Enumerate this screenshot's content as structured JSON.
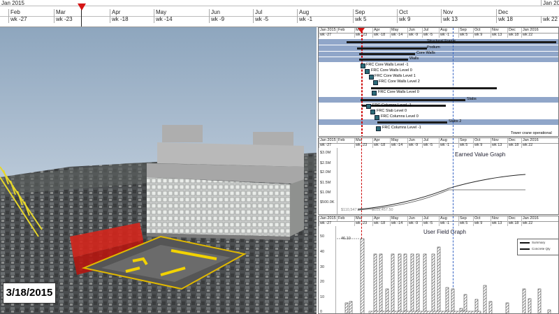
{
  "top_timeline": {
    "months": [
      {
        "label": "Jan 2015"
      },
      {
        "label": "Feb"
      },
      {
        "label": "Mar"
      },
      {
        "label": "Apr"
      },
      {
        "label": "May"
      },
      {
        "label": "Jun"
      },
      {
        "label": "Jul"
      },
      {
        "label": "Aug"
      },
      {
        "label": "Sep"
      },
      {
        "label": "Oct"
      },
      {
        "label": "Nov"
      },
      {
        "label": "Dec"
      },
      {
        "label": "Jan 2016"
      }
    ],
    "weeks": [
      "wk -27",
      "wk -23",
      "wk -18",
      "wk -14",
      "wk -9",
      "wk -5",
      "wk -1",
      "wk 5",
      "wk 9",
      "wk 13",
      "wk 18",
      "wk 22"
    ]
  },
  "view3d": {
    "date": "3/18/2015"
  },
  "gantt": {
    "months": [
      "Jan 2015",
      "Feb",
      "Mar",
      "Apr",
      "May",
      "Jun",
      "Jul",
      "Aug",
      "Sep",
      "Oct",
      "Nov",
      "Dec",
      "Jan 2016"
    ],
    "weeks": [
      "wk -27",
      "wk -23",
      "wk -18",
      "wk -14",
      "wk -9",
      "wk -5",
      "wk -1",
      "wk 5",
      "wk 9",
      "wk 13",
      "wk 18",
      "wk 22"
    ],
    "tasks": [
      "Structural Frame",
      "Podium",
      "Core Walls",
      "Walls",
      "FRC Core Walls Level -1",
      "FRC Core Walls Level 0",
      "FRC Core Walls Level 1",
      "FRC Core Walls Level 2",
      "FRC Core Walls Level 0",
      "Slabs",
      "Columns",
      "FRC Columns Level -1",
      "FRC Slab Level 0",
      "FRC Columns Level 0",
      "Slabs 2",
      "FRC Columns Level -1",
      "Tower crane operational"
    ]
  },
  "earned_value": {
    "title": "Earned Value Graph",
    "months": [
      "Jan 2015",
      "Feb",
      "Mar",
      "Apr",
      "May",
      "Jun",
      "Jul",
      "Aug",
      "Sep",
      "Oct",
      "Nov",
      "Dec",
      "Jan 2016"
    ],
    "weeks": [
      "wk -27",
      "wk -23",
      "wk -18",
      "wk -14",
      "wk -9",
      "wk -5",
      "wk -1",
      "wk 5",
      "wk 9",
      "wk 13",
      "wk 18",
      "wk 22"
    ],
    "yticks": [
      "$3.0M",
      "$2.5M",
      "$2.0M",
      "$1.5M",
      "$1.0M",
      "$500.0K"
    ],
    "value_labels": [
      "$110,547.50",
      "$109,457.50"
    ]
  },
  "user_field": {
    "title": "User Field Graph",
    "months": [
      "Jan 2015",
      "Feb",
      "Mar",
      "Apr",
      "May",
      "Jun",
      "Jul",
      "Aug",
      "Sep",
      "Oct",
      "Nov",
      "Dec",
      "Jan 2016"
    ],
    "weeks": [
      "wk -27",
      "wk -23",
      "wk -18",
      "wk -14",
      "wk -9",
      "wk -5",
      "wk -1",
      "wk 5",
      "wk 9",
      "wk 13",
      "wk 18",
      "wk 22"
    ],
    "yticks": [
      "50",
      "40",
      "30",
      "20",
      "10",
      "0"
    ],
    "marker_value": "46.10",
    "legend": [
      "Summary",
      "Concrete Qty"
    ]
  }
}
